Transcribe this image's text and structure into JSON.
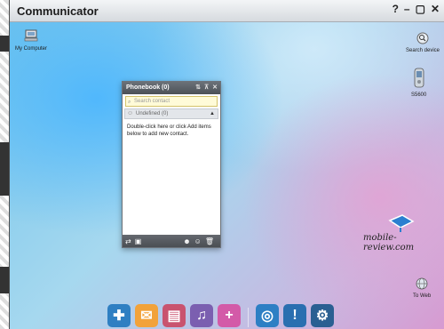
{
  "window": {
    "title": "Communicator",
    "controls": {
      "help": "?",
      "minimize": "–",
      "restore": "▢",
      "close": "✕"
    }
  },
  "desktop": {
    "my_computer": {
      "label": "My Computer",
      "icon": "computer-icon"
    },
    "search_device": {
      "label": "Search device",
      "icon": "search-icon"
    },
    "phone": {
      "label": "S5600",
      "icon": "phone-icon"
    },
    "to_web": {
      "label": "To Web",
      "icon": "globe-icon"
    }
  },
  "phonebook": {
    "title": "Phonebook (0)",
    "search_placeholder": "Search contact",
    "group_label": "Undefined (0)",
    "hint": "Double-click here or click Add items below to add new contact."
  },
  "watermark": "mobile-review.com",
  "dock": [
    {
      "name": "puzzle-icon",
      "color": "#2f7fc2"
    },
    {
      "name": "contacts-message-icon",
      "color": "#f2a23a"
    },
    {
      "name": "phone-manager-icon",
      "color": "#c9536f"
    },
    {
      "name": "media-icon",
      "color": "#7b5fb0"
    },
    {
      "name": "add-icon",
      "color": "#d35aa8"
    },
    {
      "name": "internet-icon",
      "color": "#2d7fc4"
    },
    {
      "name": "alert-icon",
      "color": "#2a6fb0"
    },
    {
      "name": "settings-icon",
      "color": "#2a5f92"
    }
  ]
}
